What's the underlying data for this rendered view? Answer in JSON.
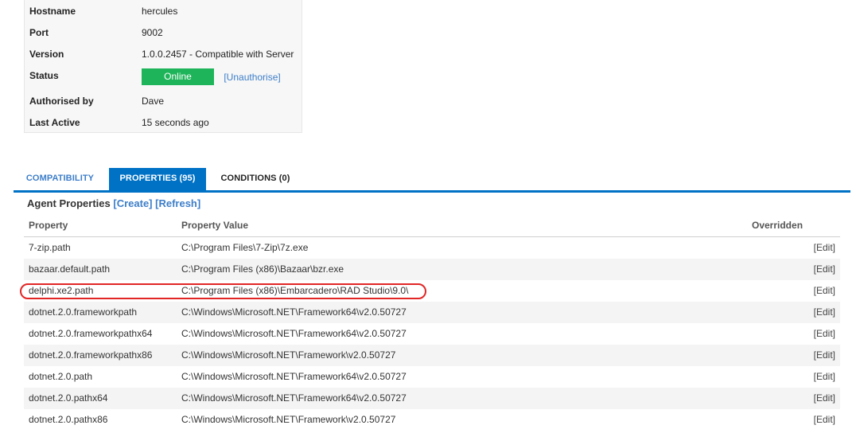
{
  "agent": {
    "rows": [
      {
        "label": "Hostname",
        "value": "hercules"
      },
      {
        "label": "Port",
        "value": "9002"
      },
      {
        "label": "Version",
        "value": "1.0.0.2457 - Compatible with Server"
      },
      {
        "label": "Status",
        "value": "Online",
        "action": "[Unauthorise]"
      },
      {
        "label": "Authorised by",
        "value": "Dave"
      },
      {
        "label": "Last Active",
        "value": "15 seconds ago"
      }
    ],
    "status_color": "#1eb55a"
  },
  "tabs": [
    {
      "label": "COMPATIBILITY",
      "active": false
    },
    {
      "label": "PROPERTIES (95)",
      "active": true
    },
    {
      "label": "CONDITIONS (0)",
      "active": false
    }
  ],
  "properties": {
    "title": "Agent Properties",
    "create_label": "[Create]",
    "refresh_label": "[Refresh]",
    "columns": [
      "Property",
      "Property Value",
      "Overridden"
    ],
    "rows": [
      {
        "property": "7-zip.path",
        "value": "C:\\Program Files\\7-Zip\\7z.exe",
        "edit": "[Edit]"
      },
      {
        "property": "bazaar.default.path",
        "value": "C:\\Program Files (x86)\\Bazaar\\bzr.exe",
        "edit": "[Edit]"
      },
      {
        "property": "delphi.xe2.path",
        "value": "C:\\Program Files (x86)\\Embarcadero\\RAD Studio\\9.0\\",
        "edit": "[Edit]",
        "highlighted": true
      },
      {
        "property": "dotnet.2.0.frameworkpath",
        "value": "C:\\Windows\\Microsoft.NET\\Framework64\\v2.0.50727",
        "edit": "[Edit]"
      },
      {
        "property": "dotnet.2.0.frameworkpathx64",
        "value": "C:\\Windows\\Microsoft.NET\\Framework64\\v2.0.50727",
        "edit": "[Edit]"
      },
      {
        "property": "dotnet.2.0.frameworkpathx86",
        "value": "C:\\Windows\\Microsoft.NET\\Framework\\v2.0.50727",
        "edit": "[Edit]"
      },
      {
        "property": "dotnet.2.0.path",
        "value": "C:\\Windows\\Microsoft.NET\\Framework64\\v2.0.50727",
        "edit": "[Edit]"
      },
      {
        "property": "dotnet.2.0.pathx64",
        "value": "C:\\Windows\\Microsoft.NET\\Framework64\\v2.0.50727",
        "edit": "[Edit]"
      },
      {
        "property": "dotnet.2.0.pathx86",
        "value": "C:\\Windows\\Microsoft.NET\\Framework\\v2.0.50727",
        "edit": "[Edit]"
      }
    ]
  },
  "accent_color": "#0072c6",
  "highlight_color": "#e22626"
}
